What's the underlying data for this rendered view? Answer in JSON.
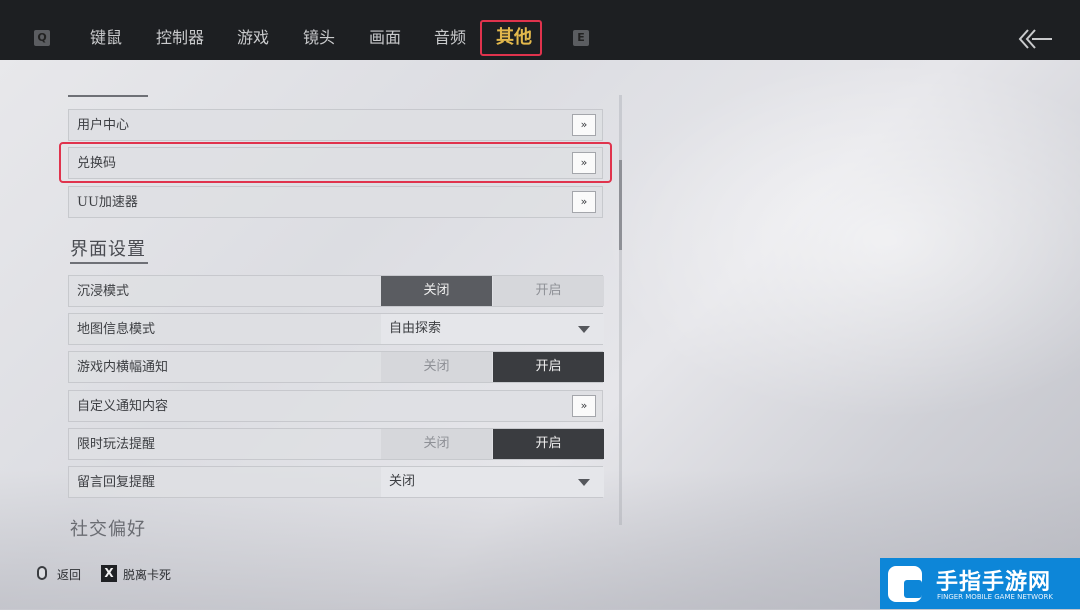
{
  "topbar": {
    "left_key": "Q",
    "right_key": "E",
    "tabs": [
      {
        "label": "键鼠"
      },
      {
        "label": "控制器"
      },
      {
        "label": "游戏"
      },
      {
        "label": "镜头"
      },
      {
        "label": "画面"
      },
      {
        "label": "音频"
      },
      {
        "label": "其他",
        "active": true
      }
    ],
    "back_icon": "back-arrow-icon",
    "active_color": "#e3b84c",
    "highlight_color": "#e0334d"
  },
  "account_section": {
    "items": [
      {
        "label": "用户中心",
        "arrow": "»"
      },
      {
        "label": "兑换码",
        "arrow": "»",
        "highlighted": true
      },
      {
        "label": "UU加速器",
        "arrow": "»"
      }
    ]
  },
  "interface_section": {
    "title": "界面设置",
    "items": [
      {
        "label": "沉浸模式",
        "type": "toggle",
        "options": [
          "关闭",
          "开启"
        ],
        "selected": "关闭"
      },
      {
        "label": "地图信息模式",
        "type": "dropdown",
        "value": "自由探索"
      },
      {
        "label": "游戏内横幅通知",
        "type": "toggle",
        "options": [
          "关闭",
          "开启"
        ],
        "selected": "开启"
      },
      {
        "label": "自定义通知内容",
        "type": "arrow",
        "arrow": "»"
      },
      {
        "label": "限时玩法提醒",
        "type": "toggle",
        "options": [
          "关闭",
          "开启"
        ],
        "selected": "开启"
      },
      {
        "label": "留言回复提醒",
        "type": "dropdown",
        "value": "关闭"
      }
    ]
  },
  "social_section": {
    "title": "社交偏好"
  },
  "footer": {
    "back_label": "返回",
    "x_key": "X",
    "unstuck_label": "脱离卡死"
  },
  "watermark": {
    "title": "手指手游网",
    "subtitle": "FINGER MOBILE GAME NETWORK"
  }
}
